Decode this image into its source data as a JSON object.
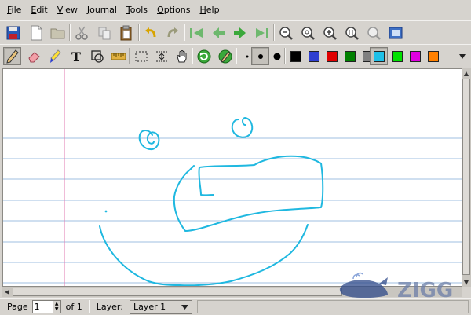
{
  "menu": [
    "File",
    "Edit",
    "View",
    "Journal",
    "Tools",
    "Options",
    "Help"
  ],
  "toolbar_main": {
    "buttons": [
      "save-icon",
      "new-page-icon",
      "open-icon",
      "cut-icon",
      "copy-icon",
      "paste-icon",
      "undo-icon",
      "redo-icon",
      "first-page-icon",
      "previous-page-icon",
      "next-page-icon",
      "last-page-icon",
      "zoom-out-icon",
      "zoom-normal-icon",
      "zoom-in-icon",
      "zoom-page-width-icon",
      "zoom-custom-icon",
      "fullscreen-icon"
    ]
  },
  "toolbar_tools": {
    "tools": [
      "pen-icon",
      "eraser-icon",
      "highlighter-icon",
      "text-icon",
      "shape-recognizer-icon",
      "ruler-icon",
      "select-rectangle-icon",
      "vertical-space-icon",
      "hand-icon",
      "default-tool-icon",
      "default-pen-icon"
    ],
    "active_tool": "pen-icon",
    "thickness": [
      "fine",
      "medium",
      "thick"
    ],
    "active_thickness": "medium",
    "colors": [
      "#000000",
      "#2f3fd0",
      "#e00000",
      "#008000",
      "#808080",
      "#1fc0e8",
      "#00e000",
      "#e000e0",
      "#ff8000"
    ],
    "active_color": "#1fc0e8"
  },
  "status": {
    "page_label": "Page",
    "page_value": "1",
    "of_label": "of 1",
    "layer_label": "Layer:",
    "layer_value": "Layer 1"
  },
  "watermark": {
    "text": "ZIGG"
  }
}
